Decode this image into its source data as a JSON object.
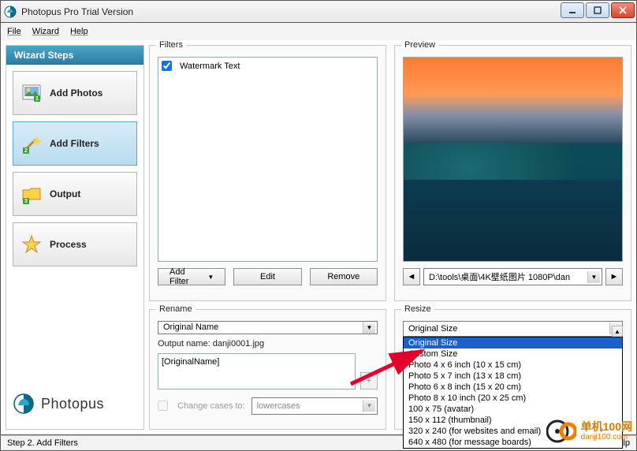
{
  "window": {
    "title": "Photopus Pro Trial Version"
  },
  "menu": {
    "file": "File",
    "wizard": "Wizard",
    "help": "Help"
  },
  "sidebar": {
    "header": "Wizard Steps",
    "brand": "Photopus",
    "steps": [
      {
        "label": "Add Photos"
      },
      {
        "label": "Add Filters"
      },
      {
        "label": "Output"
      },
      {
        "label": "Process"
      }
    ]
  },
  "filters": {
    "group_label": "Filters",
    "items": [
      {
        "name": "Watermark Text",
        "checked": true
      }
    ],
    "add_label": "Add Filter",
    "edit_label": "Edit",
    "remove_label": "Remove"
  },
  "preview": {
    "group_label": "Preview",
    "path": "D:\\tools\\桌面\\4K壁纸图片 1080P\\dan"
  },
  "rename": {
    "group_label": "Rename",
    "selected": "Original Name",
    "output_name_label": "Output name: danji0001.jpg",
    "pattern": "[OriginalName]",
    "change_cases_label": "Change cases to:",
    "change_cases_value": "lowercases",
    "change_cases_enabled": false
  },
  "resize": {
    "group_label": "Resize",
    "selected": "Original Size",
    "options": [
      "Original Size",
      "Custom Size",
      "Photo 4 x 6 inch (10 x 15 cm)",
      "Photo 5 x 7 inch (13 x 18 cm)",
      "Photo 6 x 8 inch (15 x 20 cm)",
      "Photo  8 x 10 inch (20 x 25 cm)",
      "100 x 75 (avatar)",
      "150 x 112 (thumbnail)",
      "320 x 240 (for websites and email)",
      "640 x 480 (for message boards)"
    ]
  },
  "status": {
    "step": "Step 2. Add Filters",
    "help": "F1 Help"
  },
  "watermark": {
    "brand": "单机100网",
    "url": "danji100.com"
  }
}
